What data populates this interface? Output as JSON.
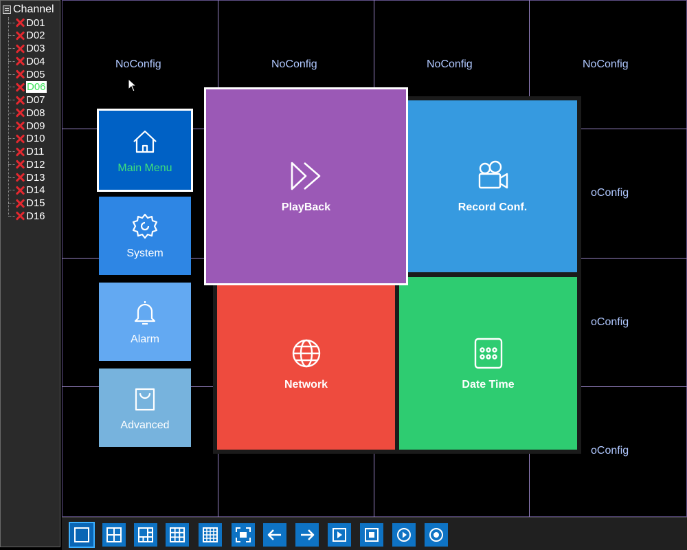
{
  "sidebar": {
    "title": "Channel",
    "channels": [
      "D01",
      "D02",
      "D03",
      "D04",
      "D05",
      "D06",
      "D07",
      "D08",
      "D09",
      "D10",
      "D11",
      "D12",
      "D13",
      "D14",
      "D15",
      "D16"
    ],
    "selected_channel": "D06",
    "status_icon": "red-x-icon"
  },
  "grid": {
    "cells": {
      "c1": "NoConfig",
      "c2": "NoConfig",
      "c3": "NoConfig",
      "c4": "NoConfig",
      "r2": "oConfig",
      "r3": "oConfig",
      "r4": "oConfig"
    },
    "line_color": "#9a86c8",
    "label_color": "#b0c8ff"
  },
  "menu": {
    "main_menu": "Main Menu",
    "system": "System",
    "alarm": "Alarm",
    "advanced": "Advanced",
    "playback": "PlayBack",
    "record_conf": "Record Conf.",
    "network": "Network",
    "date_time": "Date Time",
    "colors": {
      "main_menu": "#0061c5",
      "system": "#2e86e4",
      "alarm": "#63a9f2",
      "advanced": "#77b3dd",
      "playback": "#9b59b6",
      "record_conf": "#369ae0",
      "network": "#ee4b3e",
      "date_time": "#2ecc71"
    }
  },
  "toolbar": {
    "buttons": [
      "single-view-icon",
      "quad-view-icon",
      "six-view-icon",
      "nine-view-icon",
      "sixteen-view-icon",
      "fullscreen-icon",
      "previous-arrow-icon",
      "next-arrow-icon",
      "playback-icon",
      "record-stop-icon",
      "play-circle-icon",
      "record-circle-icon"
    ],
    "active_index": 0
  }
}
